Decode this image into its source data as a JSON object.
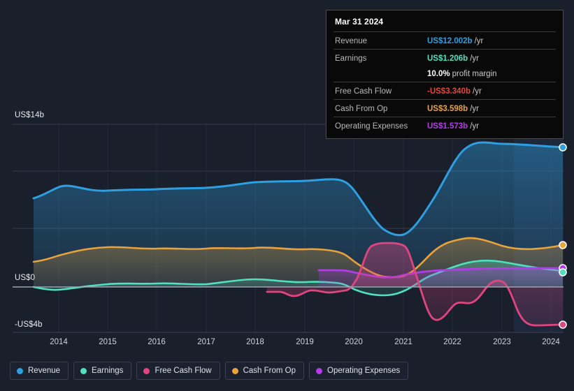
{
  "chart_data": {
    "type": "area",
    "title": "",
    "xlabel": "",
    "ylabel": "",
    "grid": true,
    "legend_position": "bottom",
    "currency": "US$",
    "units": "b",
    "x": [
      2013.6,
      2014,
      2015,
      2016,
      2017,
      2018,
      2019,
      2020,
      2021,
      2022,
      2023,
      2024,
      2024.3
    ],
    "xlim": [
      2013.6,
      2024.3
    ],
    "ylim": [
      -4,
      14
    ],
    "ytick_labels": [
      "US$14b",
      "US$0",
      "-US$4b"
    ],
    "ytick_values": [
      14,
      0,
      -4
    ],
    "xtick_labels": [
      "2014",
      "2015",
      "2016",
      "2017",
      "2018",
      "2019",
      "2020",
      "2021",
      "2022",
      "2023",
      "2024"
    ],
    "forecast_band": {
      "start_year": 2023.15,
      "end_year": 2024.3,
      "label": ""
    },
    "series": [
      {
        "name": "Revenue",
        "color": "#2e9fe0",
        "fill": "#1b4161",
        "start_year": 2013.6,
        "end_value": 12.002,
        "values": [
          8.0,
          8.3,
          9.1,
          9.35,
          9.4,
          9.55,
          9.95,
          10.1,
          10.15,
          6.35,
          11.0,
          12.05,
          12.002
        ]
      },
      {
        "name": "Earnings",
        "color": "#4fe0c0",
        "fill": "#2f5f5c",
        "start_year": 2013.6,
        "end_value": 1.206,
        "values": [
          -0.45,
          -0.35,
          -0.05,
          0.1,
          0.05,
          0.2,
          0.1,
          0.05,
          -0.75,
          0.85,
          1.95,
          1.45,
          1.206
        ]
      },
      {
        "name": "Free Cash Flow",
        "color": "#e0457f",
        "fill": "#5c2440",
        "start_year": 2018,
        "end_value": -3.34,
        "values": [
          null,
          null,
          null,
          null,
          null,
          -0.4,
          -0.45,
          -0.5,
          3.2,
          -2.95,
          -0.55,
          -3.5,
          -3.34
        ]
      },
      {
        "name": "Cash From Op",
        "color": "#e8a33d",
        "fill": "#5a5340",
        "start_year": 2013.6,
        "end_value": 3.598,
        "values": [
          1.6,
          1.95,
          2.45,
          2.35,
          2.4,
          2.4,
          2.25,
          2.1,
          0.55,
          4.25,
          5.15,
          3.9,
          3.598
        ]
      },
      {
        "name": "Operating Expenses",
        "color": "#b23ce8",
        "fill": "#47356b",
        "start_year": 2019,
        "end_value": 1.573,
        "values": [
          null,
          null,
          null,
          null,
          null,
          null,
          1.25,
          1.15,
          0.85,
          1.35,
          1.45,
          1.5,
          1.573
        ]
      }
    ]
  },
  "tooltip": {
    "date": "Mar 31 2024",
    "rows": [
      {
        "label": "Revenue",
        "value": "US$12.002b",
        "unit": "/yr",
        "color": "#2e9fe0"
      },
      {
        "label": "Earnings",
        "value": "US$1.206b",
        "unit": "/yr",
        "color": "#4fe0c0"
      },
      {
        "label": "",
        "value": "10.0%",
        "unit": "profit margin",
        "color": "#ffffff"
      },
      {
        "label": "Free Cash Flow",
        "value": "-US$3.340b",
        "unit": "/yr",
        "color": "#e8443a"
      },
      {
        "label": "Cash From Op",
        "value": "US$3.598b",
        "unit": "/yr",
        "color": "#e8a33d"
      },
      {
        "label": "Operating Expenses",
        "value": "US$1.573b",
        "unit": "/yr",
        "color": "#b23ce8"
      }
    ]
  },
  "legend": {
    "items": [
      {
        "label": "Revenue",
        "color": "#2e9fe0"
      },
      {
        "label": "Earnings",
        "color": "#4fe0c0"
      },
      {
        "label": "Free Cash Flow",
        "color": "#e0457f"
      },
      {
        "label": "Cash From Op",
        "color": "#e8a33d"
      },
      {
        "label": "Operating Expenses",
        "color": "#b23ce8"
      }
    ]
  },
  "axis": {
    "y_top": "US$14b",
    "y_zero": "US$0",
    "y_bottom": "-US$4b"
  }
}
